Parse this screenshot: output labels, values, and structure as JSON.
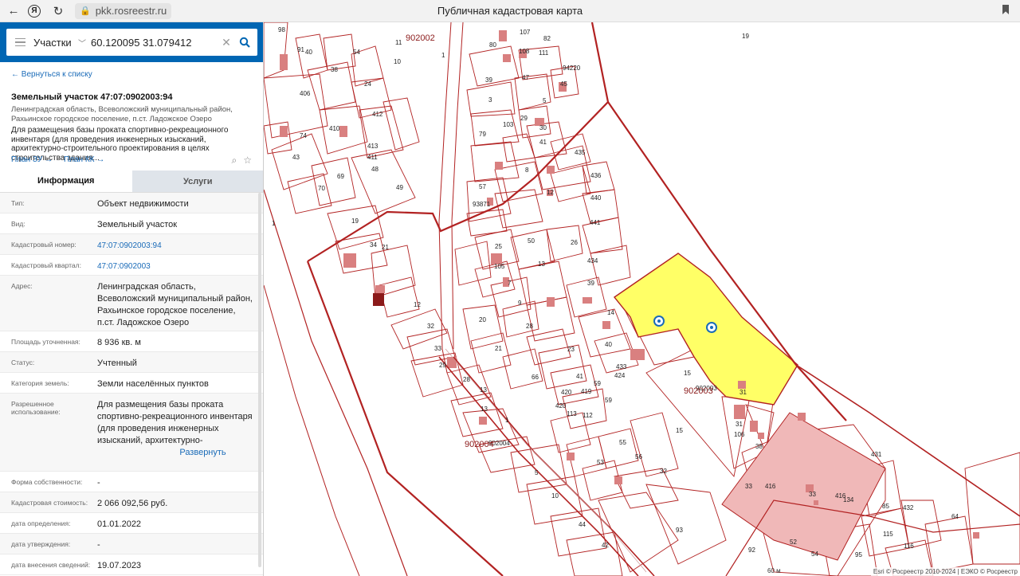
{
  "browser": {
    "url": "pkk.rosreestr.ru",
    "tab_title": "Публичная кадастровая карта"
  },
  "search": {
    "type": "Участки",
    "query": "60.120095 31.079412"
  },
  "panel": {
    "back": "← Вернуться к списку",
    "title": "Земельный участок 47:07:0902003:94",
    "address_short": "Ленинградская область, Всеволожский муниципальный район, Рахьинское городское поселение, п.ст. Ладожское Озеро",
    "description": "Для размещения базы проката спортивно-рекреационного инвентаря (для проведения инженерных изысканий, архитектурно-строительного проектирования в целях строительства здания...",
    "plan_zu": "План ЗУ →",
    "plan_kk": "План КК →",
    "tab_info": "Информация",
    "tab_services": "Услуги",
    "expand": "Развернуть"
  },
  "rows": [
    {
      "k": "Тип:",
      "v": "Объект недвижимости"
    },
    {
      "k": "Вид:",
      "v": "Земельный участок"
    },
    {
      "k": "Кадастровый номер:",
      "v": "47:07:0902003:94",
      "link": true
    },
    {
      "k": "Кадастровый квартал:",
      "v": "47:07:0902003",
      "link": true
    },
    {
      "k": "Адрес:",
      "v": "Ленинградская область, Всеволожский муниципальный район, Рахьинское городское поселение, п.ст. Ладожское Озеро"
    },
    {
      "k": "Площадь уточненная:",
      "v": "8 936 кв. м"
    },
    {
      "k": "Статус:",
      "v": "Учтенный"
    },
    {
      "k": "Категория земель:",
      "v": "Земли населённых пунктов"
    },
    {
      "k": "Разрешенное использование:",
      "v": "Для размещения базы проката спортивно-рекреационного инвентаря (для проведения инженерных изысканий, архитектурно-строительного проектирования в целях",
      "expand": true
    },
    {
      "k": "Форма собственности:",
      "v": "-"
    },
    {
      "k": "Кадастровая стоимость:",
      "v": "2 066 092,56 руб."
    },
    {
      "k": "дата определения:",
      "v": "01.01.2022"
    },
    {
      "k": "дата утверждения:",
      "v": "-"
    },
    {
      "k": "дата внесения сведений:",
      "v": "19.07.2023"
    }
  ],
  "map": {
    "attribution": "Esri © Росреестр 2010-2024 | ЕЭКО © Росреестр",
    "scale": "60 м",
    "block_labels": [
      "902002",
      "902003",
      "902004"
    ],
    "parcel_labels": [
      "98",
      "91",
      "40",
      "1",
      "11",
      "10",
      "54",
      "38",
      "24",
      "406",
      "412",
      "410",
      "411",
      "413",
      "74",
      "43",
      "48",
      "69",
      "70",
      "49",
      "19",
      "34",
      "21",
      "12",
      "32",
      "33",
      "29",
      "28",
      "13",
      "13",
      "1",
      "902004",
      "107",
      "82",
      "80",
      "108",
      "111",
      "94220",
      "45",
      "39",
      "47",
      "3",
      "5",
      "79",
      "29",
      "30",
      "103",
      "41",
      "435",
      "436",
      "8",
      "12",
      "440",
      "441",
      "57",
      "93871",
      "50",
      "25",
      "26",
      "105",
      "13",
      "434",
      "7",
      "39",
      "9",
      "28",
      "20",
      "21",
      "14",
      "40",
      "23",
      "433",
      "424",
      "419",
      "66",
      "41",
      "59",
      "59",
      "420",
      "420",
      "113",
      "112",
      "15",
      "902003",
      "31",
      "31",
      "106",
      "15",
      "55",
      "56",
      "53",
      "32",
      "5",
      "10",
      "44",
      "42",
      "93",
      "38",
      "33",
      "416",
      "33",
      "416",
      "134",
      "431",
      "432",
      "85",
      "115",
      "64",
      "95",
      "92",
      "54",
      "52",
      "116",
      "19",
      "1"
    ],
    "highlight_color": "#ffff66",
    "parcel_color": "#b22222"
  }
}
